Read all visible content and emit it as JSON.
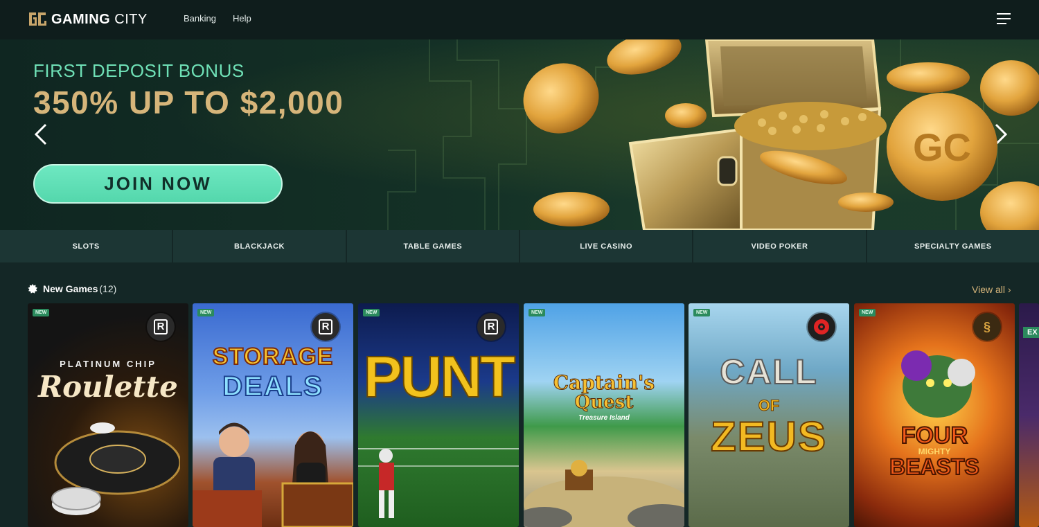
{
  "header": {
    "logo_text_1": "GAMING",
    "logo_text_2": "CITY",
    "nav": [
      "Banking",
      "Help"
    ]
  },
  "hero": {
    "subtitle": "FIRST DEPOSIT BONUS",
    "title": "350% UP TO $2,000",
    "cta": "JOIN NOW"
  },
  "categories": [
    "SLOTS",
    "BLACKJACK",
    "TABLE GAMES",
    "LIVE CASINO",
    "VIDEO POKER",
    "SPECIALTY GAMES"
  ],
  "new_games": {
    "title": "New Games",
    "count": "(12)",
    "view_all": "View all",
    "badge": "NEW",
    "tiles": [
      {
        "line1": "PLATINUM CHIP",
        "line2": "Roulette"
      },
      {
        "line1": "STORAGE",
        "line2": "DEALS"
      },
      {
        "line1": "PUNT"
      },
      {
        "line1": "Captain's",
        "line2": "Quest",
        "line3": "Treasure Island"
      },
      {
        "line1": "CALL",
        "line2": "OF",
        "line3": "ZEUS"
      },
      {
        "line1": "FOUR",
        "line2": "MIGHTY",
        "line3": "BEASTS"
      }
    ],
    "partial_tile_text": "EX"
  },
  "colors": {
    "background": "#142726",
    "header": "#0f1d1c",
    "accent_green": "#54d7ac",
    "gold": "#d6b57a"
  }
}
